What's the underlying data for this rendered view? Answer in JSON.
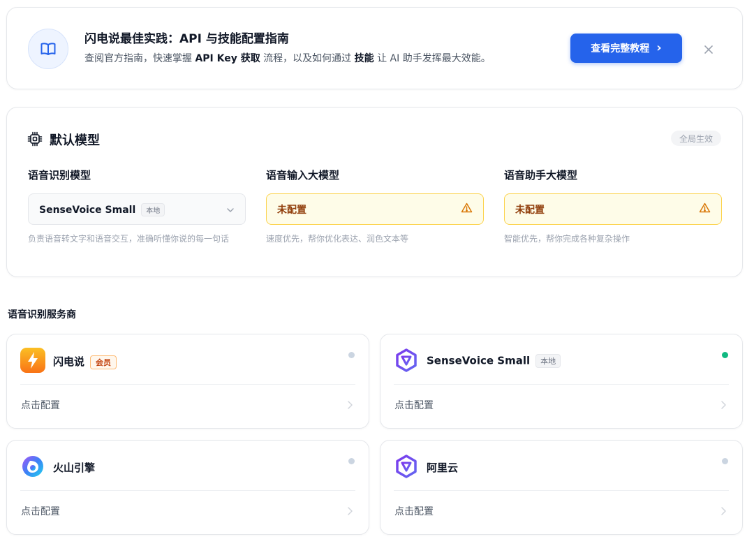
{
  "banner": {
    "title": "闪电说最佳实践：API 与技能配置指南",
    "desc_parts": {
      "p1": "查阅官方指南，快速掌握 ",
      "b1": "API Key 获取",
      "p2": " 流程，以及如何通过 ",
      "b2": "技能",
      "p3": " 让 AI 助手发挥最大效能。"
    },
    "cta_label": "查看完整教程",
    "cta_arrow": "›",
    "icon": "book-icon",
    "close_icon": "close-icon"
  },
  "default_model": {
    "title": "默认模型",
    "icon": "chip-icon",
    "scope_badge": "全局生效",
    "columns": [
      {
        "label": "语音识别模型",
        "value": "SenseVoice Small",
        "tag": "本地",
        "state": "normal",
        "trailing_icon": "chevron-down-icon",
        "desc": "负责语音转文字和语音交互，准确听懂你说的每一句话"
      },
      {
        "label": "语音输入大模型",
        "value": "未配置",
        "state": "warn",
        "trailing_icon": "warning-icon",
        "desc": "速度优先，帮你优化表达、润色文本等"
      },
      {
        "label": "语音助手大模型",
        "value": "未配置",
        "state": "warn",
        "trailing_icon": "warning-icon",
        "desc": "智能优先，帮你完成各种复杂操作"
      }
    ]
  },
  "providers": {
    "section_title": "语音识别服务商",
    "items": [
      {
        "name": "闪电说",
        "tag": "会员",
        "tag_type": "member",
        "status": "inactive",
        "status_color": "#cbd5e1",
        "action": "点击配置",
        "logo": "lightning-logo"
      },
      {
        "name": "SenseVoice Small",
        "tag": "本地",
        "tag_type": "local",
        "status": "active",
        "status_color": "#10b981",
        "action": "点击配置",
        "logo": "sensevoice-logo"
      },
      {
        "name": "火山引擎",
        "tag": "",
        "tag_type": "",
        "status": "inactive",
        "status_color": "#cbd5e1",
        "action": "点击配置",
        "logo": "volcano-logo"
      },
      {
        "name": "阿里云",
        "tag": "",
        "tag_type": "",
        "status": "inactive",
        "status_color": "#cbd5e1",
        "action": "点击配置",
        "logo": "aliyun-logo"
      }
    ]
  },
  "colors": {
    "accent": "#2563eb",
    "warn_bg": "#fefce8",
    "warn_border": "#fcd34d",
    "warn_text": "#92400e",
    "status_active": "#10b981",
    "status_inactive": "#cbd5e1"
  }
}
